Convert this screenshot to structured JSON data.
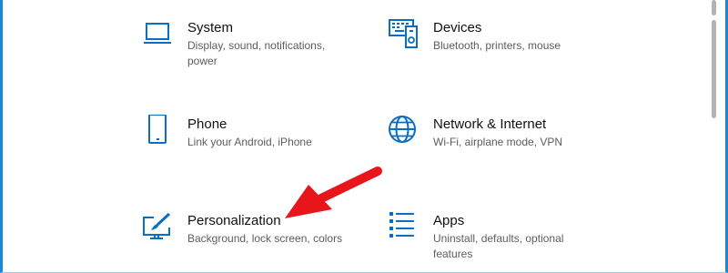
{
  "colors": {
    "accent": "#0a6fc4",
    "arrow": "#e8151b",
    "window_border": "#1e88d6"
  },
  "settings": {
    "tiles": [
      {
        "icon": "laptop-icon",
        "title": "System",
        "description": "Display, sound, notifications, power"
      },
      {
        "icon": "devices-icon",
        "title": "Devices",
        "description": "Bluetooth, printers, mouse"
      },
      {
        "icon": "phone-icon",
        "title": "Phone",
        "description": "Link your Android, iPhone"
      },
      {
        "icon": "globe-icon",
        "title": "Network & Internet",
        "description": "Wi-Fi, airplane mode, VPN"
      },
      {
        "icon": "personalization-icon",
        "title": "Personalization",
        "description": "Background, lock screen, colors"
      },
      {
        "icon": "apps-icon",
        "title": "Apps",
        "description": "Uninstall, defaults, optional features"
      }
    ]
  },
  "annotation": {
    "arrow_target": "Personalization"
  }
}
